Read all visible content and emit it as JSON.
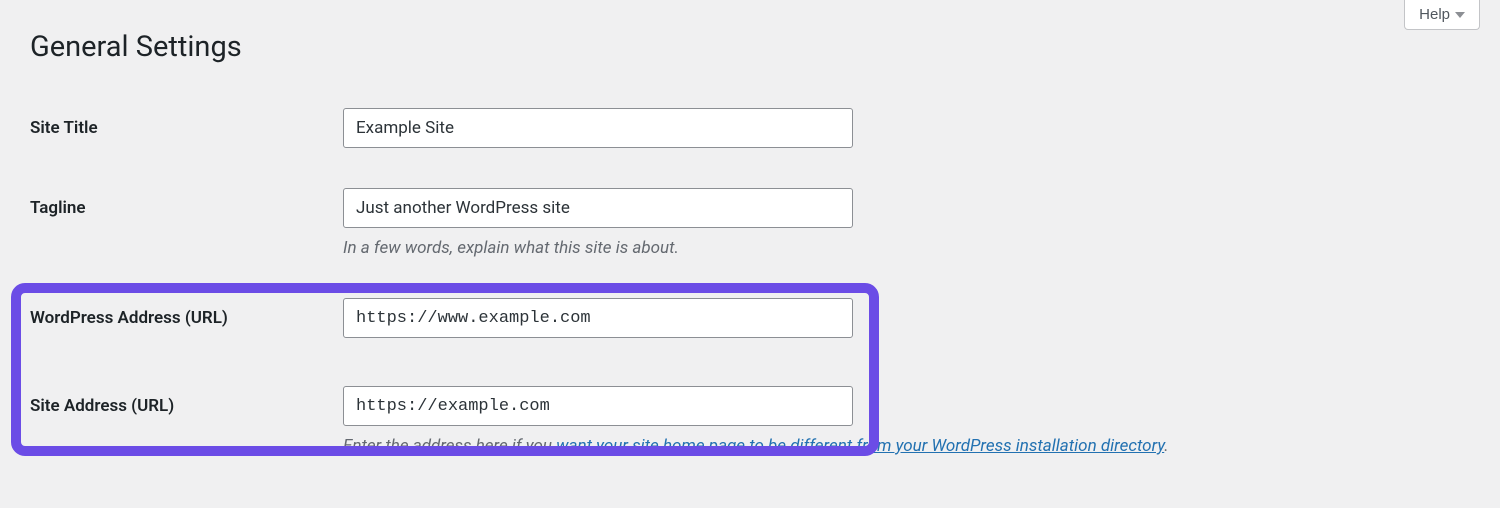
{
  "help": {
    "label": "Help"
  },
  "page": {
    "title": "General Settings"
  },
  "fields": {
    "site_title": {
      "label": "Site Title",
      "value": "Example Site"
    },
    "tagline": {
      "label": "Tagline",
      "value": "Just another WordPress site",
      "description": "In a few words, explain what this site is about."
    },
    "wp_url": {
      "label": "WordPress Address (URL)",
      "value": "https://www.example.com"
    },
    "site_url": {
      "label": "Site Address (URL)",
      "value": "https://example.com",
      "description_prefix": "Enter the address here if you ",
      "description_link": "want your site home page to be different from your WordPress installation directory",
      "description_suffix": "."
    }
  }
}
